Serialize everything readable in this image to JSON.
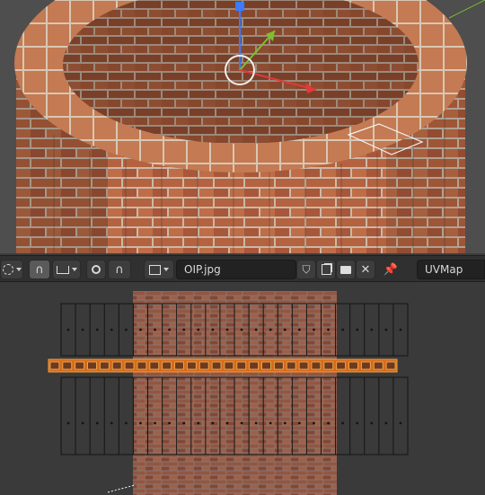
{
  "toolbar": {
    "image_name": "OIP.jpg",
    "uv_map_name": "UVMap",
    "icons": [
      "pivot-icon",
      "snap-icon",
      "snap-grid-icon",
      "proportional-edit-icon",
      "falloff-icon",
      "image-browse-icon",
      "fake-user-shield-icon",
      "duplicate-image-icon",
      "open-image-icon",
      "close-image-icon",
      "pin-icon"
    ]
  },
  "colors": {
    "brick": "#b0603e",
    "mortar": "#c9b9a8",
    "editor_bg": "#3a3a3a",
    "header_bg": "#303030",
    "uv_wire": "#1b1b1b",
    "selected_face": "#e07a1e"
  },
  "viewport": {
    "gizmo_axes": [
      "X",
      "Y",
      "Z"
    ]
  }
}
